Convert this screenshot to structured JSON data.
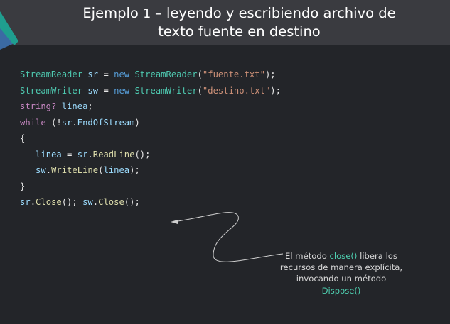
{
  "colors": {
    "background": "#232529",
    "header_background": "#3a3b40",
    "logo_teal": "#1f9e8f",
    "logo_blue": "#3b6aa3",
    "highlight": "#4ecfb0"
  },
  "slide": {
    "title_line1_prefix": "Ejemplo ",
    "title_number": "1",
    "title_line1_rest": " – leyendo y escribiendo archivo de",
    "title_line2": "texto fuente en destino"
  },
  "code": {
    "line1": {
      "type": "StreamReader",
      "var": "sr",
      "op": "=",
      "kw": "new",
      "ctor": "StreamReader",
      "open": "(",
      "arg": "\"fuente.txt\"",
      "close": ");"
    },
    "line2": {
      "type": "StreamWriter",
      "var": "sw",
      "op": "=",
      "kw": "new",
      "ctor": "StreamWriter",
      "open": "(",
      "arg": "\"destino.txt\"",
      "close": ");"
    },
    "line3": {
      "type": "string?",
      "var": "linea",
      "end": ";"
    },
    "line4": {
      "kw": "while",
      "open": "(!",
      "obj": "sr",
      "dot": ".",
      "prop": "EndOfStream",
      "close": ")"
    },
    "line5": "{",
    "line6": {
      "var": "linea",
      "op": "=",
      "obj": "sr",
      "dot": ".",
      "method": "ReadLine",
      "end": "();"
    },
    "line7": {
      "obj": "sw",
      "dot": ".",
      "method": "WriteLine",
      "open": "(",
      "arg": "linea",
      "close": ");"
    },
    "line8": "}",
    "line9": {
      "obj1": "sr",
      "dot1": ".",
      "method1": "Close",
      "end1": "(); ",
      "obj2": "sw",
      "dot2": ".",
      "method2": "Close",
      "end2": "();"
    }
  },
  "annotation": {
    "prefix": "El método ",
    "method1": "close()",
    "middle": "libera los recursos de manera explícita, invocando un método",
    "method2": "Dispose()"
  }
}
